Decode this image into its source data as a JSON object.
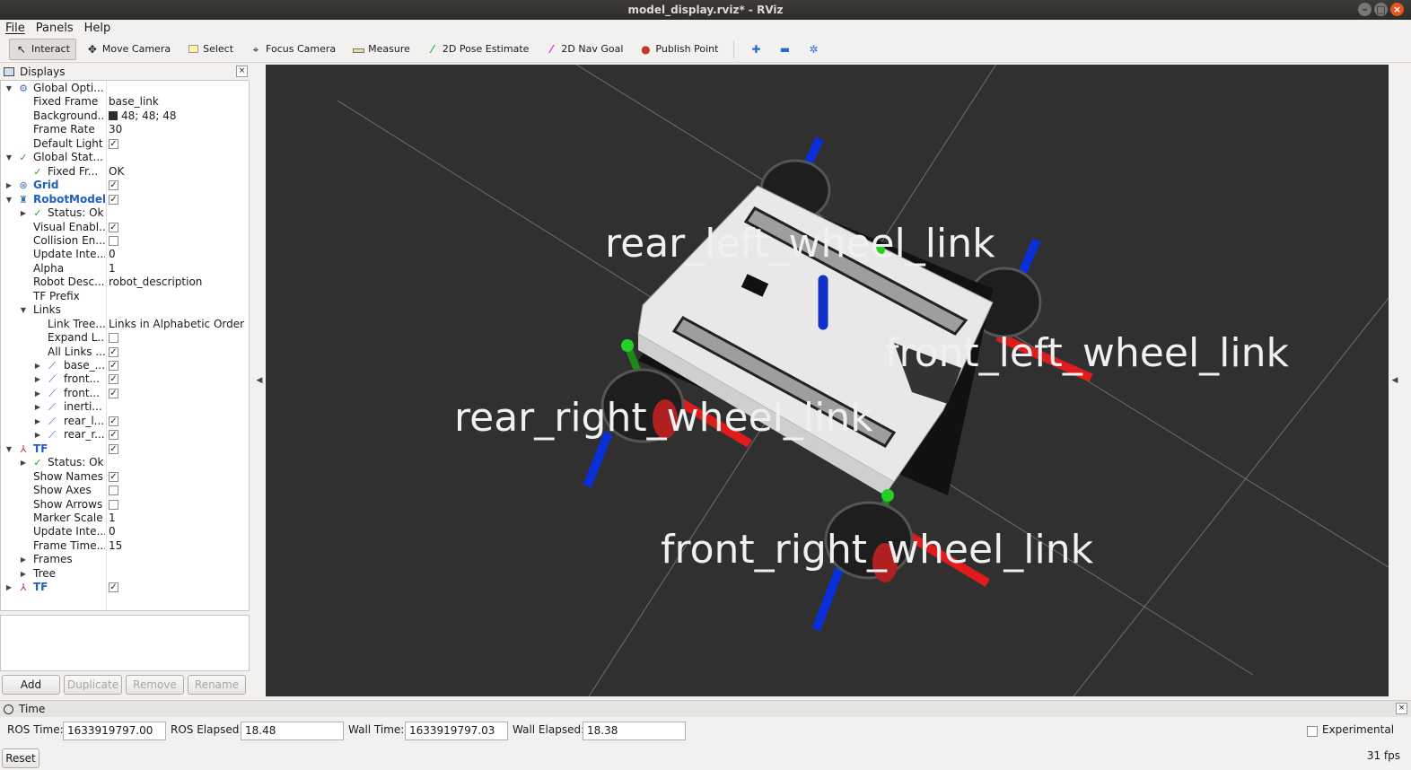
{
  "window": {
    "title": "model_display.rviz* - RViz"
  },
  "menu": {
    "file": "File",
    "panels": "Panels",
    "help": "Help"
  },
  "toolbar": {
    "interact": "Interact",
    "move_camera": "Move Camera",
    "select": "Select",
    "focus_camera": "Focus Camera",
    "measure": "Measure",
    "pose_estimate": "2D Pose Estimate",
    "nav_goal": "2D Nav Goal",
    "publish_point": "Publish Point"
  },
  "displays": {
    "title": "Displays",
    "tree": {
      "global_options": "Global Opti...",
      "fixed_frame": "Fixed Frame",
      "fixed_frame_val": "base_link",
      "background": "Background...",
      "background_val": "48; 48; 48",
      "frame_rate": "Frame Rate",
      "frame_rate_val": "30",
      "default_light": "Default Light",
      "global_status": "Global Stat...",
      "fixed_fr": "Fixed Fr...",
      "fixed_fr_val": "OK",
      "grid": "Grid",
      "robot_model": "RobotModel",
      "status_ok": "Status: Ok",
      "visual_enabled": "Visual Enabl...",
      "collision_enabled": "Collision En...",
      "update_interval": "Update Inte...",
      "update_interval_val": "0",
      "alpha": "Alpha",
      "alpha_val": "1",
      "robot_description": "Robot Desc...",
      "robot_description_val": "robot_description",
      "tf_prefix": "TF Prefix",
      "links": "Links",
      "link_tree": "Link Tree...",
      "link_tree_val": "Links in Alphabetic Order",
      "expand_links": "Expand L...",
      "all_links": "All Links ...",
      "link_base": "base_...",
      "link_front1": "front...",
      "link_front2": "front...",
      "link_inertia": "inerti...",
      "link_rear_l": "rear_l...",
      "link_rear_r": "rear_r...",
      "tf": "TF",
      "tf_status_ok": "Status: Ok",
      "show_names": "Show Names",
      "show_axes": "Show Axes",
      "show_arrows": "Show Arrows",
      "marker_scale": "Marker Scale",
      "marker_scale_val": "1",
      "tf_update_interval": "Update Inte...",
      "tf_update_interval_val": "0",
      "frame_timeout": "Frame Time...",
      "frame_timeout_val": "15",
      "frames": "Frames",
      "tree": "Tree",
      "tf2": "TF"
    },
    "buttons": {
      "add": "Add",
      "duplicate": "Duplicate",
      "remove": "Remove",
      "rename": "Rename"
    }
  },
  "viewport": {
    "labels": {
      "rear_left": "rear_left_wheel_link",
      "front_left": "front_left_wheel_link",
      "rear_right": "rear_right_wheel_link",
      "front_right": "front_right_wheel_link"
    },
    "background": "#303030"
  },
  "time": {
    "title": "Time",
    "ros_time_label": "ROS Time:",
    "ros_time": "1633919797.00",
    "ros_elapsed_label": "ROS Elapsed:",
    "ros_elapsed": "18.48",
    "wall_time_label": "Wall Time:",
    "wall_time": "1633919797.03",
    "wall_elapsed_label": "Wall Elapsed:",
    "wall_elapsed": "18.38",
    "experimental": "Experimental",
    "reset": "Reset",
    "fps": "31 fps"
  }
}
